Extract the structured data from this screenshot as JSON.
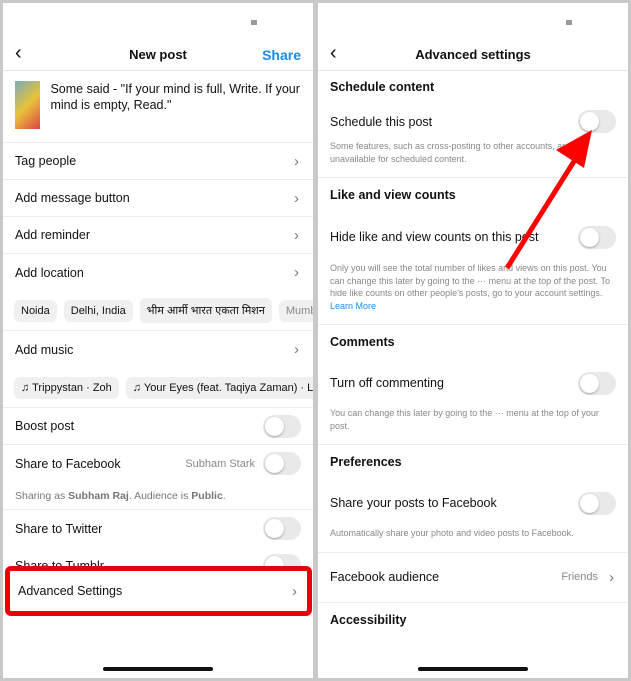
{
  "left": {
    "title": "New post",
    "share": "Share",
    "caption": "Some said - \"If your mind is full, Write. If your mind is empty, Read.\"",
    "rows": [
      "Tag people",
      "Add message button",
      "Add reminder",
      "Add location"
    ],
    "locations": [
      "Noida",
      "Delhi, India",
      "भीम आर्मी भारत एकता मिशन",
      "Mumbai"
    ],
    "add_music": "Add music",
    "music": [
      "Trippystan · Zoh",
      "Your Eyes (feat. Taqiya Zaman) · L"
    ],
    "boost": "Boost post",
    "facebook": "Share to Facebook",
    "facebook_account": "Subham Stark",
    "sharing_as_prefix": "Sharing as ",
    "sharing_name": "Subham Raj",
    "sharing_mid": ". Audience is ",
    "sharing_aud": "Public",
    "sharing_end": ".",
    "twitter": "Share to Twitter",
    "tumblr": "Share to Tumblr",
    "advanced": "Advanced Settings"
  },
  "right": {
    "title": "Advanced settings",
    "schedule_header": "Schedule content",
    "schedule": "Schedule this post",
    "schedule_note": "Some features, such as cross-posting to other accounts, are unavailable for scheduled content.",
    "likes_header": "Like and view counts",
    "likes": "Hide like and view counts on this post",
    "likes_note": "Only you will see the total number of likes and views on this post. You can change this later by going to the ··· menu at the top of the post. To hide like counts on other people's posts, go to your account settings.",
    "learn_more": "Learn More",
    "comments_header": "Comments",
    "comments": "Turn off commenting",
    "comments_note": "You can change this later by going to the ··· menu at the top of your post.",
    "pref_header": "Preferences",
    "pref": "Share your posts to Facebook",
    "pref_note": "Automatically share your photo and video posts to Facebook.",
    "fb_audience": "Facebook audience",
    "fb_audience_value": "Friends",
    "accessibility": "Accessibility"
  },
  "colors": {
    "accent": "#1a8cf0",
    "highlight": "#e8000b",
    "arrow": "#f00"
  }
}
